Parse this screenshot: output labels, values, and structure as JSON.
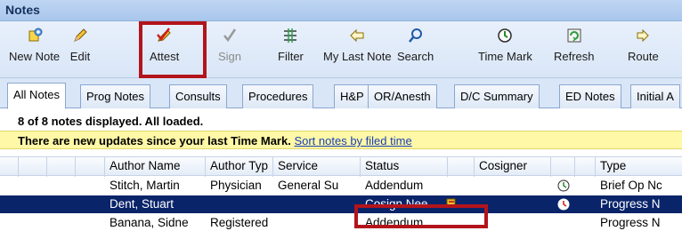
{
  "window": {
    "title": "Notes"
  },
  "toolbar": {
    "buttons": [
      {
        "label": "New Note",
        "icon": "new-note-icon",
        "disabled": false
      },
      {
        "label": "Edit",
        "icon": "pencil-icon",
        "disabled": false
      },
      {
        "label": "Attest",
        "icon": "attest-icon",
        "disabled": false,
        "highlighted": true
      },
      {
        "label": "Sign",
        "icon": "checkmark-icon",
        "disabled": true
      },
      {
        "label": "Filter",
        "icon": "filter-icon",
        "disabled": false
      },
      {
        "label": "My Last Note",
        "icon": "arrow-left-icon",
        "disabled": false
      },
      {
        "label": "Search",
        "icon": "search-icon",
        "disabled": false
      },
      {
        "label": "Time Mark",
        "icon": "clock-icon",
        "disabled": false
      },
      {
        "label": "Refresh",
        "icon": "refresh-icon",
        "disabled": false
      },
      {
        "label": "Route",
        "icon": "route-icon",
        "disabled": false
      }
    ]
  },
  "tabs": [
    "All Notes",
    "Prog Notes",
    "Consults",
    "Procedures",
    "H&P",
    "OR/Anesth",
    "D/C Summary",
    "ED Notes",
    "Initial A"
  ],
  "status": "8 of 8 notes displayed. All loaded.",
  "banner": {
    "text": "There are new updates since your last Time Mark.",
    "link": "Sort notes by filed time"
  },
  "grid": {
    "columns": [
      "Author Name",
      "Author Typ",
      "Service",
      "Status",
      "Cosigner",
      "Type"
    ],
    "rows": [
      {
        "author": "Stitch, Martin",
        "author_type": "Physician",
        "service": "General Su",
        "status": "Addendum",
        "cosigner": "",
        "type": "Brief Op Nc",
        "selected": false
      },
      {
        "author": "Dent, Stuart",
        "author_type": "",
        "service": "",
        "status": "Cosign Nee",
        "cosigner": "",
        "type": "Progress N",
        "selected": true
      },
      {
        "author": "Banana, Sidne",
        "author_type": "Registered",
        "service": "",
        "status": "Addendum",
        "cosigner": "",
        "type": "Progress N",
        "selected": false
      }
    ]
  },
  "colors": {
    "highlight": "#b3141b",
    "selection": "#0a246a",
    "banner": "#fff8a6",
    "link": "#1a3fb8"
  }
}
